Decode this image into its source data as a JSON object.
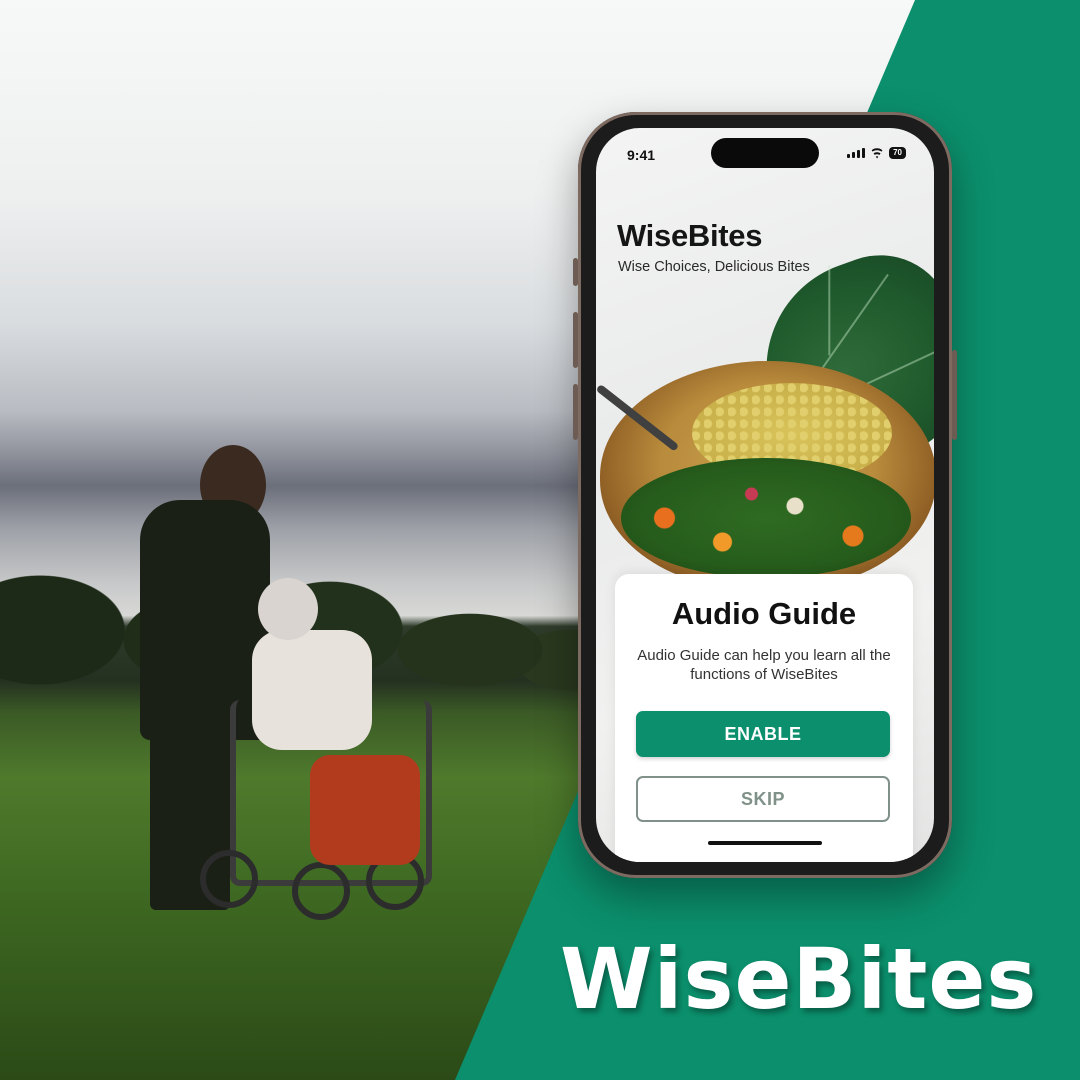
{
  "status_bar": {
    "time": "9:41",
    "battery": "70"
  },
  "app": {
    "title": "WiseBites",
    "subtitle": "Wise Choices, Delicious Bites"
  },
  "audio_guide": {
    "title": "Audio Guide",
    "description": "Audio Guide can help you learn all the functions of WiseBites",
    "enable_label": "ENABLE",
    "skip_label": "SKIP"
  },
  "brand": {
    "name": "WiseBites"
  },
  "colors": {
    "accent": "#0b8f6c",
    "skip_border": "#7f9189"
  }
}
